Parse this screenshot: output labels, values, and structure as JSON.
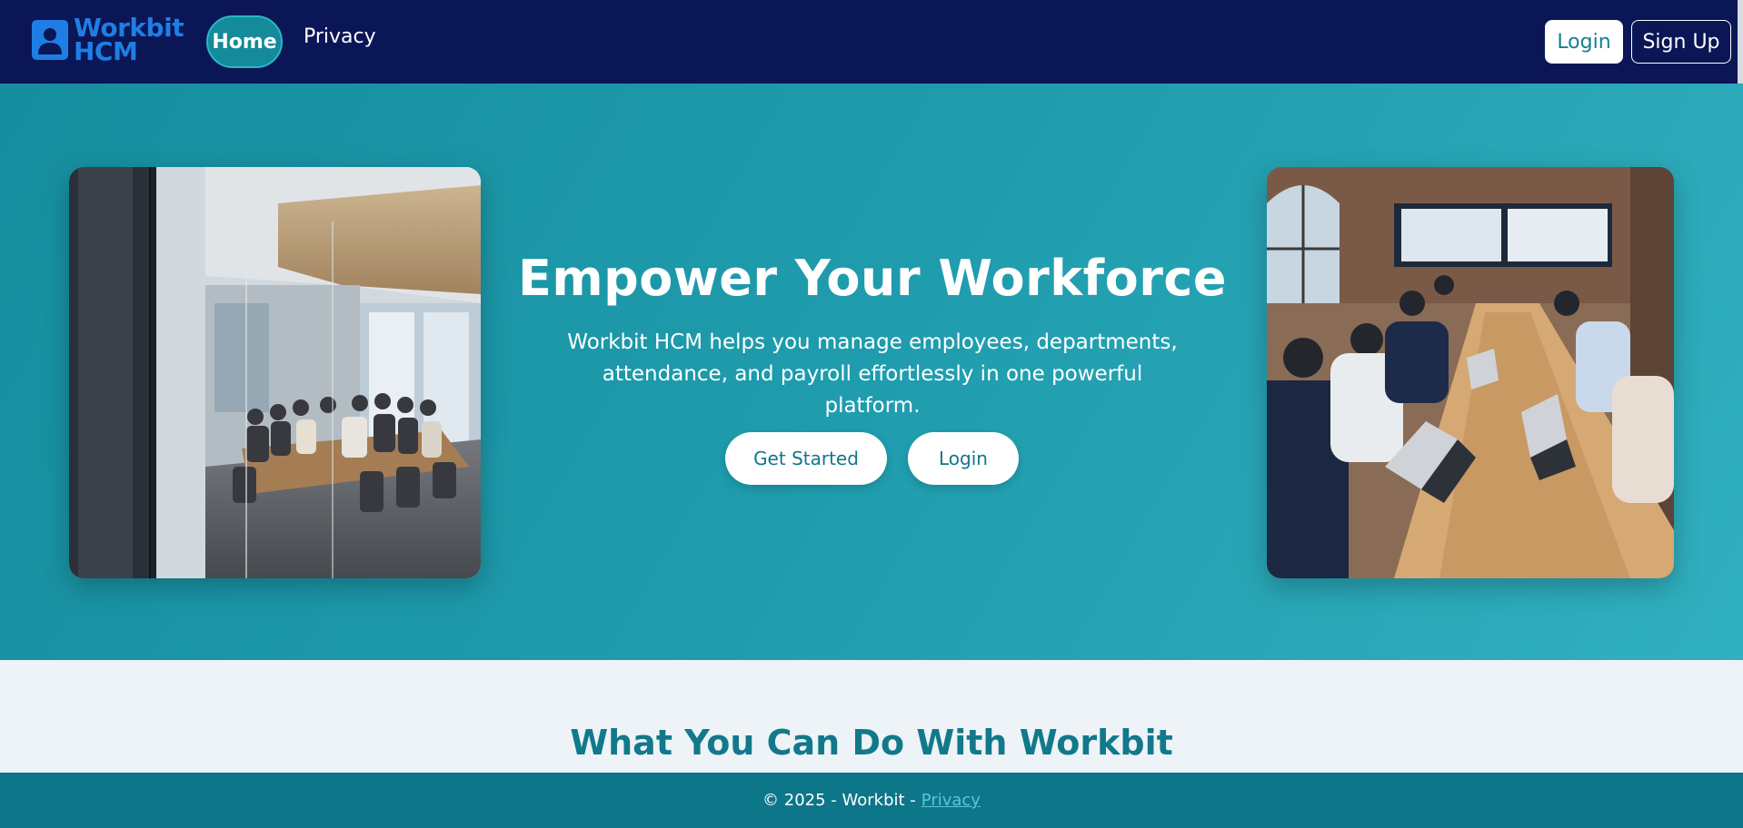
{
  "brand": {
    "line1": "Workbit",
    "line2": "HCM",
    "icon": "user-badge-icon",
    "color": "#1f7ee4"
  },
  "nav": {
    "home_label": "Home",
    "privacy_label": "Privacy",
    "login_label": "Login",
    "signup_label": "Sign Up"
  },
  "hero": {
    "title": "Empower Your Workforce",
    "subtitle": "Workbit HCM helps you manage employees, departments, attendance, and payroll effortlessly in one powerful platform.",
    "get_started_label": "Get Started",
    "login_label": "Login",
    "left_image": "conference-room-meeting-photo",
    "right_image": "team-working-on-laptops-photo"
  },
  "features": {
    "title": "What You Can Do With Workbit"
  },
  "footer": {
    "text": "© 2025 - Workbit -",
    "privacy_label": "Privacy"
  },
  "colors": {
    "navbar": "#0a1656",
    "hero": "#1f9cad",
    "footer": "#0d7689",
    "accent": "#11798b"
  }
}
